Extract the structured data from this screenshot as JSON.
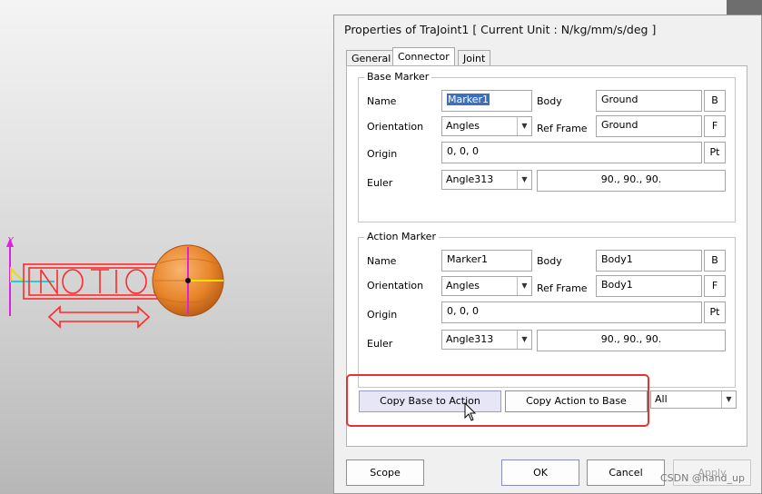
{
  "dialog": {
    "title": "Properties of TraJoint1 [ Current Unit : N/kg/mm/s/deg ]",
    "tabs": [
      {
        "label": "General",
        "active": false
      },
      {
        "label": "Connector",
        "active": true
      },
      {
        "label": "Joint",
        "active": false
      }
    ]
  },
  "base_marker": {
    "group_title": "Base Marker",
    "name_label": "Name",
    "name_value": "Marker1",
    "body_label": "Body",
    "body_value": "Ground",
    "body_button": "B",
    "orientation_label": "Orientation",
    "orientation_value": "Angles",
    "ref_frame_label": "Ref Frame",
    "ref_frame_value": "Ground",
    "ref_frame_button": "F",
    "origin_label": "Origin",
    "origin_value": "0, 0, 0",
    "origin_button": "Pt",
    "euler_label": "Euler",
    "euler_type": "Angle313",
    "euler_value": "90., 90., 90."
  },
  "action_marker": {
    "group_title": "Action Marker",
    "name_label": "Name",
    "name_value": "Marker1",
    "body_label": "Body",
    "body_value": "Body1",
    "body_button": "B",
    "orientation_label": "Orientation",
    "orientation_value": "Angles",
    "ref_frame_label": "Ref Frame",
    "ref_frame_value": "Body1",
    "ref_frame_button": "F",
    "origin_label": "Origin",
    "origin_value": "0, 0, 0",
    "origin_button": "Pt",
    "euler_label": "Euler",
    "euler_type": "Angle313",
    "euler_value": "90., 90., 90."
  },
  "copy": {
    "base_to_action": "Copy Base to Action",
    "action_to_base": "Copy Action to Base",
    "scope_value": "All"
  },
  "footer": {
    "scope": "Scope",
    "ok": "OK",
    "cancel": "Cancel",
    "apply": "Apply"
  },
  "viewport": {
    "axis_label": "Y"
  },
  "watermark": "CSDN @hand_up",
  "colors": {
    "highlight": "#e33333",
    "sphere": "#e8852a",
    "joint_outline": "#ff2a2a",
    "axis_magenta": "#e020e0",
    "axis_yellow": "#f0e000"
  }
}
